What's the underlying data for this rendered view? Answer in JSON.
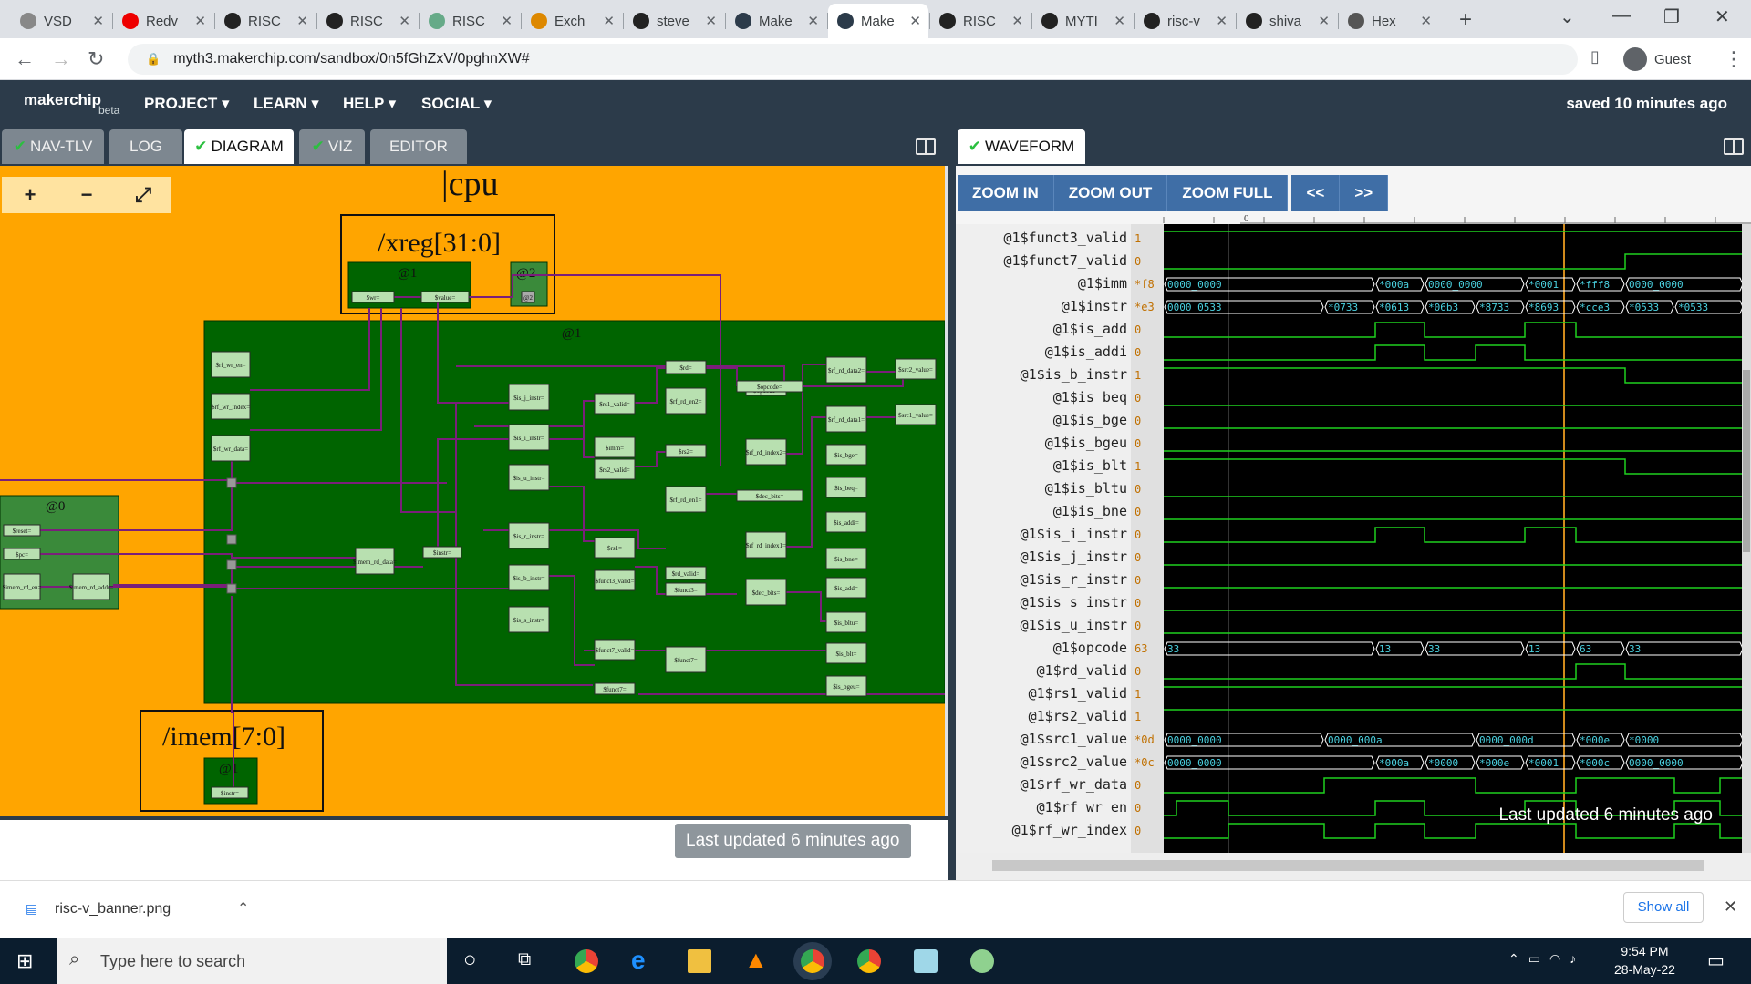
{
  "browser": {
    "tabs": [
      {
        "label": "VSD",
        "color": "#888"
      },
      {
        "label": "Redv",
        "color": "#e00"
      },
      {
        "label": "RISC",
        "color": "#222"
      },
      {
        "label": "RISC",
        "color": "#222"
      },
      {
        "label": "RISC",
        "color": "#6a8"
      },
      {
        "label": "Exch",
        "color": "#d80"
      },
      {
        "label": "steve",
        "color": "#222"
      },
      {
        "label": "Make",
        "color": "#2c3b4a"
      },
      {
        "label": "Make",
        "color": "#2c3b4a"
      },
      {
        "label": "RISC",
        "color": "#222"
      },
      {
        "label": "MYTI",
        "color": "#222"
      },
      {
        "label": "risc-v",
        "color": "#222"
      },
      {
        "label": "shiva",
        "color": "#222"
      },
      {
        "label": "Hex",
        "color": "#555"
      }
    ],
    "url": "myth3.makerchip.com/sandbox/0n5fGhZxV/0pghnXW#",
    "profile": "Guest"
  },
  "app": {
    "logo": "makerchip",
    "beta": "beta",
    "menus": [
      "PROJECT",
      "LEARN",
      "HELP",
      "SOCIAL"
    ],
    "saved": "saved 10 minutes ago"
  },
  "left_tabs": [
    {
      "label": "NAV-TLV",
      "check": true
    },
    {
      "label": "LOG",
      "check": false
    },
    {
      "label": "DIAGRAM",
      "check": true
    },
    {
      "label": "VIZ",
      "check": true
    },
    {
      "label": "EDITOR",
      "check": false
    }
  ],
  "diagram": {
    "zoom_in": "+",
    "zoom_out": "−",
    "fit": "⤢",
    "title": "|cpu",
    "xreg": {
      "label": "/xreg[31:0]",
      "stage1": "@1",
      "stage2": "@2",
      "sig1": "$wr=",
      "sig2": "$value="
    },
    "main_stage": "@1",
    "left_stage": "@0",
    "imem": {
      "label": "/imem[7:0]",
      "stage": "@1",
      "sig": "$instr="
    },
    "left_sigs": [
      "$reset=",
      "$pc=",
      "$imem_rd_en=",
      "$imem_rd_addr="
    ],
    "mid_sigs": [
      "$rf_wr_en=",
      "$rf_wr_index=",
      "$rf_wr_data=",
      "$imem_rd_data=",
      "$instr="
    ],
    "decode_sigs": [
      "$is_j_instr=",
      "$is_i_instr=",
      "$is_u_instr=",
      "$is_r_instr=",
      "$is_b_instr=",
      "$is_s_instr="
    ],
    "col2": [
      "$rs1_valid=",
      "$imm=",
      "$rs2_valid=",
      "$rs1=",
      "$funct3_valid=",
      "$funct7_valid="
    ],
    "col3": [
      "$rd=",
      "$rf_rd_en2=",
      "$rs2=",
      "$rf_rd_en1=",
      "$rd_valid=",
      "$funct3=",
      "$funct7="
    ],
    "col4": [
      "$rf_rd_index2=",
      "$rf_rd_index1=",
      "$dec_bits=",
      "$opcode="
    ],
    "col5": [
      "$rf_rd_data2=",
      "$rf_rd_data1=",
      "$is_bge=",
      "$is_beq=",
      "$is_addi=",
      "$is_bne=",
      "$is_add=",
      "$is_bltu=",
      "$is_blt=",
      "$is_bgeu="
    ],
    "col6": [
      "$src2_value=",
      "$src1_value="
    ],
    "status": "Last updated 6 minutes ago"
  },
  "waveform": {
    "tab": "WAVEFORM",
    "buttons": [
      "ZOOM IN",
      "ZOOM OUT",
      "ZOOM FULL",
      "<<",
      ">>"
    ],
    "ruler_label": "0",
    "signals": [
      {
        "name": "@1$funct3_valid",
        "val": "1"
      },
      {
        "name": "@1$funct7_valid",
        "val": "0"
      },
      {
        "name": "@1$imm",
        "val": "*f8"
      },
      {
        "name": "@1$instr",
        "val": "*e3"
      },
      {
        "name": "@1$is_add",
        "val": "0"
      },
      {
        "name": "@1$is_addi",
        "val": "0"
      },
      {
        "name": "@1$is_b_instr",
        "val": "1"
      },
      {
        "name": "@1$is_beq",
        "val": "0"
      },
      {
        "name": "@1$is_bge",
        "val": "0"
      },
      {
        "name": "@1$is_bgeu",
        "val": "0"
      },
      {
        "name": "@1$is_blt",
        "val": "1"
      },
      {
        "name": "@1$is_bltu",
        "val": "0"
      },
      {
        "name": "@1$is_bne",
        "val": "0"
      },
      {
        "name": "@1$is_i_instr",
        "val": "0"
      },
      {
        "name": "@1$is_j_instr",
        "val": "0"
      },
      {
        "name": "@1$is_r_instr",
        "val": "0"
      },
      {
        "name": "@1$is_s_instr",
        "val": "0"
      },
      {
        "name": "@1$is_u_instr",
        "val": "0"
      },
      {
        "name": "@1$opcode",
        "val": "63"
      },
      {
        "name": "@1$rd_valid",
        "val": "0"
      },
      {
        "name": "@1$rs1_valid",
        "val": "1"
      },
      {
        "name": "@1$rs2_valid",
        "val": "1"
      },
      {
        "name": "@1$src1_value",
        "val": "*0d"
      },
      {
        "name": "@1$src2_value",
        "val": "*0c"
      },
      {
        "name": "@1$rf_wr_data",
        "val": "0"
      },
      {
        "name": "@1$rf_wr_en",
        "val": "0"
      },
      {
        "name": "@1$rf_wr_index",
        "val": "0"
      }
    ],
    "bus_labels": {
      "imm": [
        "0000_0000",
        "*000a",
        "0000_0000",
        "*0001",
        "*fff8",
        "0000_0000"
      ],
      "instr": [
        "0000_0533",
        "*0733",
        "*0613",
        "*06b3",
        "*8733",
        "*8693",
        "*cce3",
        "*0533",
        "*0533"
      ],
      "opcode": [
        "33",
        "13",
        "33",
        "13",
        "63",
        "33"
      ],
      "src1": [
        "0000_0000",
        "0000_000a",
        "0000_000d",
        "*000e",
        "*0000"
      ],
      "src2": [
        "0000_0000",
        "*000a",
        "*0000",
        "*000e",
        "*0001",
        "*000c",
        "0000_0000"
      ]
    },
    "status": "Last updated 6 minutes ago"
  },
  "downloads": {
    "file": "risc-v_banner.png",
    "show_all": "Show all"
  },
  "taskbar": {
    "search": "Type here to search",
    "time": "9:54 PM",
    "date": "28-May-22"
  }
}
